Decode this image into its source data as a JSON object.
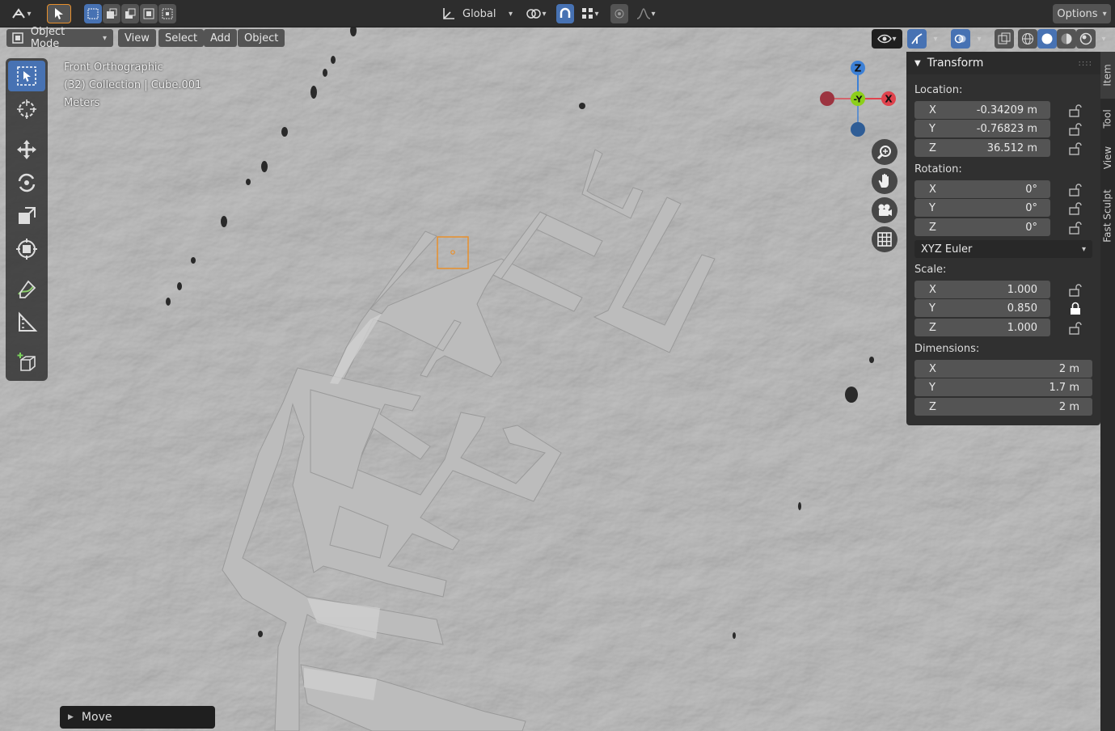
{
  "header": {
    "orientation": "Global",
    "options": "Options",
    "mode": "Object Mode",
    "menus": [
      "View",
      "Select",
      "Add",
      "Object"
    ]
  },
  "viewport_info": {
    "view": "Front Orthographic",
    "collection": "(32) Collection | Cube.001",
    "units": "Meters"
  },
  "gizmo": {
    "z": "Z",
    "y": "-Y",
    "x": "X"
  },
  "transform": {
    "title": "Transform",
    "location_label": "Location:",
    "location": [
      {
        "axis": "X",
        "value": "-0.34209 m"
      },
      {
        "axis": "Y",
        "value": "-0.76823 m"
      },
      {
        "axis": "Z",
        "value": "36.512 m"
      }
    ],
    "rotation_label": "Rotation:",
    "rotation": [
      {
        "axis": "X",
        "value": "0°"
      },
      {
        "axis": "Y",
        "value": "0°"
      },
      {
        "axis": "Z",
        "value": "0°"
      }
    ],
    "rotation_mode": "XYZ Euler",
    "scale_label": "Scale:",
    "scale": [
      {
        "axis": "X",
        "value": "1.000"
      },
      {
        "axis": "Y",
        "value": "0.850"
      },
      {
        "axis": "Z",
        "value": "1.000"
      }
    ],
    "dimensions_label": "Dimensions:",
    "dimensions": [
      {
        "axis": "X",
        "value": "2 m"
      },
      {
        "axis": "Y",
        "value": "1.7 m"
      },
      {
        "axis": "Z",
        "value": "2 m"
      }
    ]
  },
  "side_tabs": [
    "Item",
    "Tool",
    "View",
    "Fast Sculpt"
  ],
  "last_operator": "Move",
  "colors": {
    "accent": "#4772b3",
    "selection": "#e8902c",
    "axis_x": "#e0434d",
    "axis_y": "#8ccf1a",
    "axis_z": "#3c80d6"
  },
  "icons": [
    "editor-type-icon",
    "select-box-icon",
    "transform-orientation-icon",
    "pivot-icon",
    "snap-icon",
    "proportional-edit-icon",
    "visibility-icon",
    "gizmo-icon",
    "overlay-icon",
    "xray-icon",
    "wireframe-shading-icon",
    "solid-shading-icon",
    "material-shading-icon",
    "rendered-shading-icon",
    "cursor-tool-icon",
    "move-tool-icon",
    "rotate-tool-icon",
    "scale-tool-icon",
    "transform-tool-icon",
    "annotate-tool-icon",
    "measure-tool-icon",
    "add-cube-tool-icon",
    "zoom-icon",
    "pan-hand-icon",
    "camera-icon",
    "grid-icon",
    "lock-icon"
  ]
}
